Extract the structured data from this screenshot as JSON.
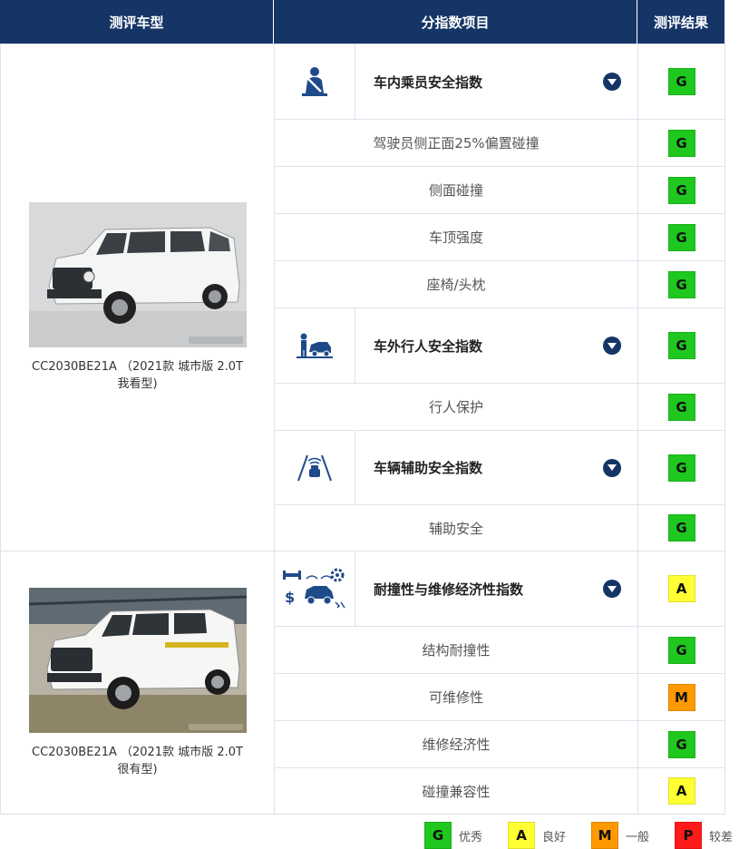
{
  "header": {
    "col_vehicle": "测评车型",
    "col_items": "分指数项目",
    "col_result": "测评结果"
  },
  "vehicles": [
    {
      "caption": "CC2030BE21A （2021款 城市版 2.0T 我看型)",
      "photo_icon": "white-suv-photo"
    },
    {
      "caption": "CC2030BE21A （2021款 城市版 2.0T 很有型)",
      "photo_icon": "white-suv-test-photo"
    }
  ],
  "indexes": [
    {
      "title": "车内乘员安全指数",
      "icon": "seatbelt-occupant-icon",
      "rating": "G",
      "items": [
        {
          "label": "驾驶员侧正面25%偏置碰撞",
          "rating": "G"
        },
        {
          "label": "侧面碰撞",
          "rating": "G"
        },
        {
          "label": "车顶强度",
          "rating": "G"
        },
        {
          "label": "座椅/头枕",
          "rating": "G"
        }
      ]
    },
    {
      "title": "车外行人安全指数",
      "icon": "pedestrian-car-icon",
      "rating": "G",
      "items": [
        {
          "label": "行人保护",
          "rating": "G"
        }
      ]
    },
    {
      "title": "车辆辅助安全指数",
      "icon": "lane-assist-icon",
      "rating": "G",
      "items": [
        {
          "label": "辅助安全",
          "rating": "G"
        }
      ]
    },
    {
      "title": "耐撞性与维修经济性指数",
      "icon": "repair-economy-icon",
      "rating": "A",
      "items": [
        {
          "label": "结构耐撞性",
          "rating": "G"
        },
        {
          "label": "可维修性",
          "rating": "M"
        },
        {
          "label": "维修经济性",
          "rating": "G"
        },
        {
          "label": "碰撞兼容性",
          "rating": "A"
        }
      ]
    }
  ],
  "legend": [
    {
      "code": "G",
      "label": "优秀"
    },
    {
      "code": "A",
      "label": "良好"
    },
    {
      "code": "M",
      "label": "一般"
    },
    {
      "code": "P",
      "label": "较差"
    }
  ],
  "colors": {
    "header_bg": "#163567",
    "G": "#1ec81e",
    "A": "#ffff33",
    "M": "#ff9900",
    "P": "#ff1a1a"
  }
}
